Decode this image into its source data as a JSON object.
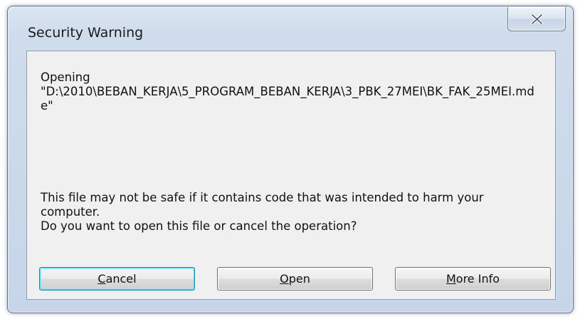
{
  "dialog": {
    "title": "Security Warning"
  },
  "message": {
    "opening_label": "Opening",
    "file_path": "\"D:\\2010\\BEBAN_KERJA\\5_PROGRAM_BEBAN_KERJA\\3_PBK_27MEI\\BK_FAK_25MEI.mde\"",
    "warning_line1": "This file may not be safe if it contains code that was intended to harm your computer.",
    "warning_line2": "Do you want to open this file or cancel the operation?"
  },
  "buttons": {
    "cancel": {
      "accel": "C",
      "rest": "ancel"
    },
    "open": {
      "accel": "O",
      "rest": "pen"
    },
    "more_info": {
      "accel": "M",
      "rest": "ore Info"
    }
  },
  "icons": {
    "close": "close-icon"
  },
  "colors": {
    "window_frame": "#cfdcec",
    "client_bg": "#f0f0f0",
    "default_button_border": "#3c7fb1"
  }
}
